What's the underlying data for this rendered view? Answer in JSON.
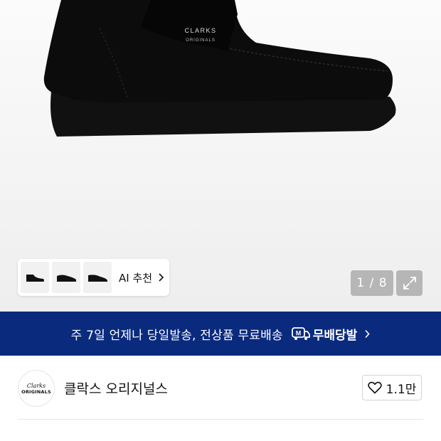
{
  "product_image": {
    "logo_brand": "CLARKS",
    "logo_sub": "ORIGINALS"
  },
  "ai_recommend": {
    "label": "AI 추천",
    "thumbnail_count": 3
  },
  "gallery": {
    "counter": "1 / 8"
  },
  "banner": {
    "text": "주 7일 언제나 당일발송, 전상품 무료배송",
    "badge_icon_letter": "M",
    "badge_label": "무배당발",
    "background_color": "#0a2a7e"
  },
  "brand": {
    "logo_line1": "Clarks",
    "logo_line2": "ORIGINALS",
    "name": "클락스 오리지널스"
  },
  "like": {
    "count": "1.1만"
  },
  "icons": {
    "ai_chevron": "chevron-right-icon",
    "expand": "expand-arrows-icon",
    "banner_chevron": "chevron-right-icon",
    "delivery_badge": "delivery-truck-icon",
    "like": "heart-outline-icon"
  }
}
